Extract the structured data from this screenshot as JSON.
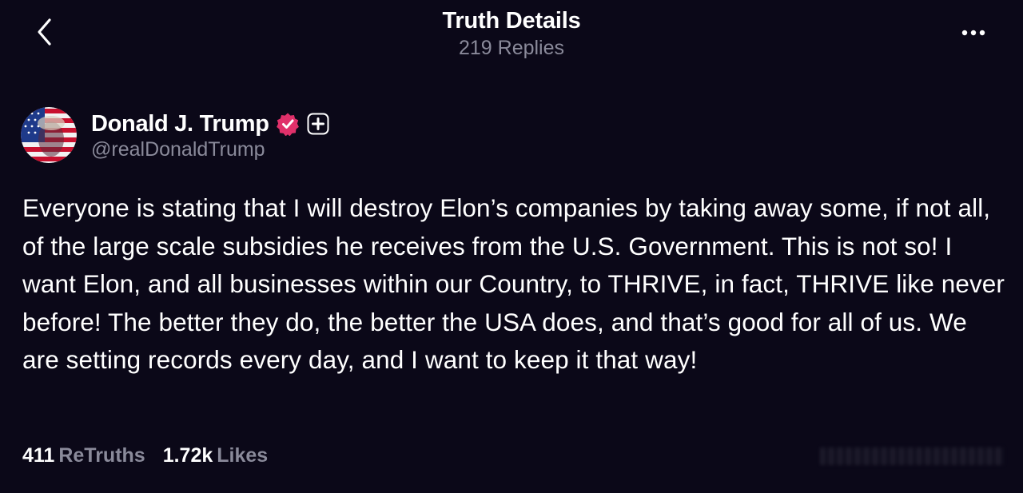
{
  "header": {
    "title": "Truth Details",
    "subtitle": "219 Replies"
  },
  "author": {
    "name": "Donald J. Trump",
    "handle": "@realDonaldTrump",
    "verified_color": "#e0306a"
  },
  "post": {
    "text": "Everyone is stating that I will destroy Elon’s companies by taking away some, if not all, of the large scale subsidies he receives from the U.S. Government. This is not so! I want Elon, and all businesses within our Country, to THRIVE, in fact, THRIVE like never before! The better they do, the better the USA does, and that’s good for all of us. We are setting records every day, and I want to keep it that way!"
  },
  "stats": {
    "retruths_count": "411",
    "retruths_label": "ReTruths",
    "likes_count": "1.72k",
    "likes_label": "Likes"
  },
  "icons": {
    "back": "chevron-left-icon",
    "more": "more-horizontal-icon",
    "verified": "verified-badge-icon",
    "plus": "plus-badge-icon"
  }
}
